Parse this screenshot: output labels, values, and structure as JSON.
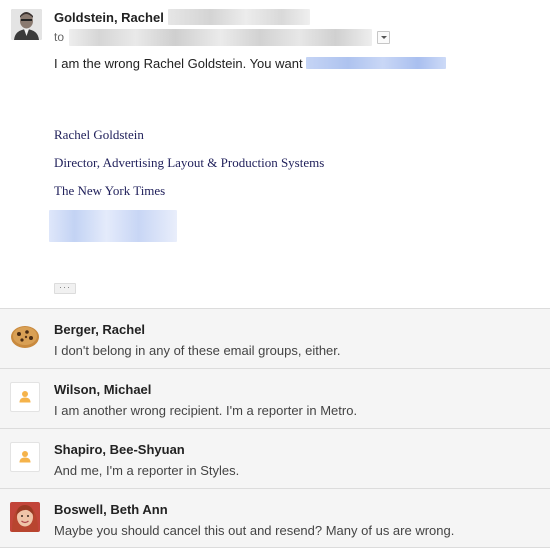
{
  "thread": {
    "expanded_message": {
      "sender_name": "Goldstein, Rachel",
      "to_label": "to",
      "body_text": "I am the wrong Rachel Goldstein.  You want",
      "signature": {
        "name": "Rachel Goldstein",
        "title": "Director, Advertising Layout & Production Systems",
        "organization": "The New York Times"
      },
      "show_trimmed_label": "···"
    },
    "collapsed_messages": [
      {
        "sender_name": "Berger, Rachel",
        "snippet": "I don't belong in any of these email groups, either.",
        "avatar_type": "cookie-photo"
      },
      {
        "sender_name": "Wilson, Michael",
        "snippet": "I am another wrong recipient. I'm a reporter in Metro.",
        "avatar_type": "default-person"
      },
      {
        "sender_name": "Shapiro, Bee-Shyuan",
        "snippet": "And me, I'm a reporter in Styles.",
        "avatar_type": "default-person"
      },
      {
        "sender_name": "Boswell, Beth Ann",
        "snippet": "Maybe you should cancel this out and resend? Many of us are wrong.",
        "avatar_type": "woman-photo"
      }
    ]
  },
  "colors": {
    "collapsed_background": "#f5f5f5",
    "signature_text": "#1f1f5a",
    "placeholder_person": "#f5b34a",
    "redaction_blue": "#a8bff0"
  }
}
